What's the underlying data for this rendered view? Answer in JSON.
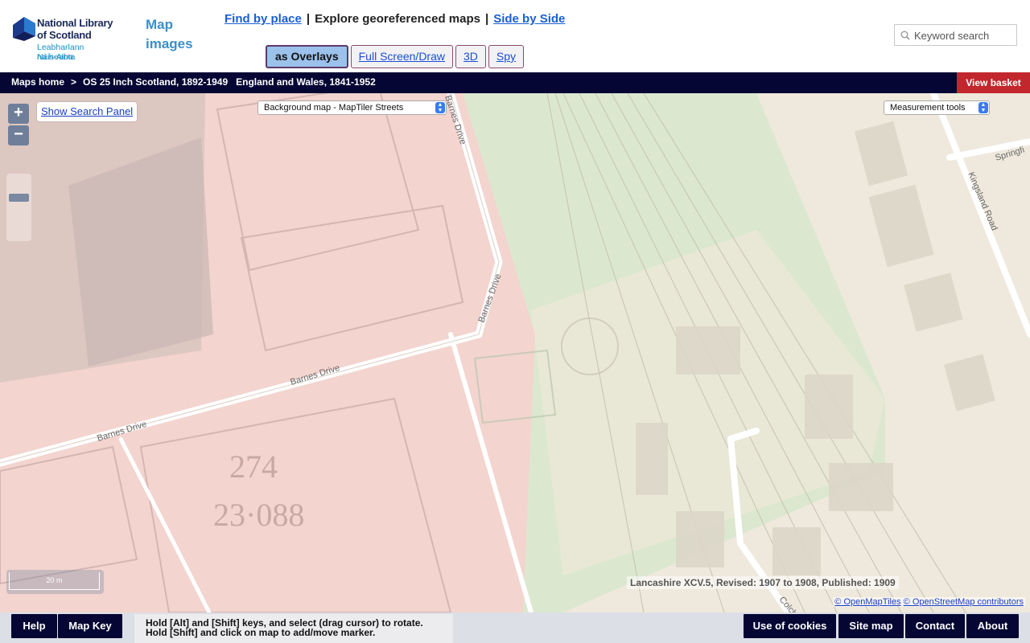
{
  "header": {
    "logo": {
      "line1": "National Library",
      "line2": "of Scotland",
      "line3": "Leabharlann Nàiseanta",
      "line4": "na h-Alba"
    },
    "app_title": "Map images",
    "nav": {
      "find_by_place": "Find by place",
      "separator": "|",
      "current": "Explore georeferenced maps",
      "side_by_side": "Side by Side"
    },
    "view_tabs": [
      "as Overlays",
      "Full Screen/Draw",
      "3D",
      "Spy"
    ],
    "active_view_tab": "as Overlays",
    "keyword_search": {
      "placeholder": "Keyword search",
      "value": ""
    }
  },
  "breadcrumb": {
    "home": "Maps home",
    "arrow": ">",
    "series_1": "OS 25 Inch Scotland, 1892-1949",
    "series_2": "England and Wales, 1841-1952",
    "basket": "View basket"
  },
  "map": {
    "zoom_in": "+",
    "zoom_out": "−",
    "show_search_panel": "Show Search Panel",
    "background_map": "Background map - MapTiler Streets",
    "measurement_tools": "Measurement tools",
    "scale_label": "20 m",
    "sheet_info": "Lancashire XCV.5, Revised: 1907 to 1908, Published: 1909",
    "attribution": {
      "a1": "© OpenMapTiles",
      "a2": "© OpenStreetMap contributors"
    },
    "labels": {
      "barnes_drive_top": "Barnes Drive",
      "barnes_drive_bend": "Barnes Drive",
      "barnes_drive_mid": "Barnes Drive",
      "barnes_drive_left": "Barnes Drive",
      "kingsland_road": "Kingsland Road",
      "springfield": "Springfi",
      "colch": "Colch",
      "parcel_number": "274",
      "parcel_area": "23·088"
    },
    "colors": {
      "pink_area": "#f3d4cf",
      "green_area": "#dbe8cf",
      "base": "#efe9dd",
      "road": "#ffffff"
    }
  },
  "footer": {
    "help": "Help",
    "map_key": "Map Key",
    "hint_line1": "Hold [Alt] and [Shift] keys, and select (drag cursor) to rotate.",
    "hint_line2": "Hold [Shift] and click on map to add/move marker.",
    "use_of_cookies": "Use of cookies",
    "site_map": "Site map",
    "contact": "Contact",
    "about": "About"
  }
}
